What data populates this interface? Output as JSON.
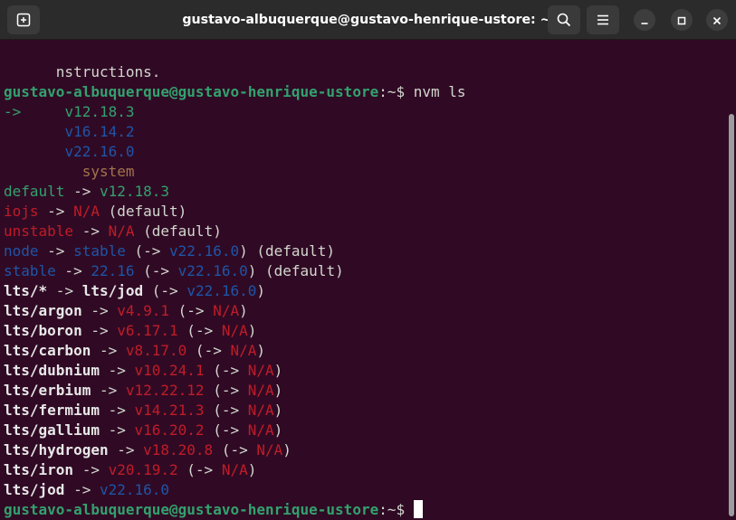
{
  "window": {
    "title": "gustavo-albuquerque@gustavo-henrique-ustore: ~",
    "icons": {
      "new_tab": "new-tab-icon",
      "search": "search-icon",
      "menu": "hamburger-menu-icon",
      "minimize": "minimize-icon",
      "maximize": "maximize-icon",
      "close": "close-icon"
    }
  },
  "colors": {
    "background": "#300a24",
    "prompt_green": "#33a16e",
    "blue": "#1e55a8",
    "red": "#c01c28",
    "text": "#d3d7cf"
  },
  "terminal": {
    "prev_output": "nstructions.",
    "prompt": {
      "user_host": "gustavo-albuquerque@gustavo-henrique-ustore",
      "path_suffix": ":~$ ",
      "command": "nvm ls"
    },
    "versions": {
      "arrow": "->",
      "current": "v12.18.3",
      "v2": "v16.14.2",
      "v3": "v22.16.0",
      "system": "system"
    },
    "aliases": {
      "default": {
        "name": "default",
        "arrow": " -> ",
        "target": "v12.18.3"
      },
      "iojs": {
        "name": "iojs",
        "arrow": " -> ",
        "target": "N/A",
        "suffix": " (default)"
      },
      "unstable": {
        "name": "unstable",
        "arrow": " -> ",
        "target": "N/A",
        "suffix": " (default)"
      },
      "node": {
        "name": "node",
        "arrow": " -> ",
        "target": "stable",
        "open": " (",
        "arrow2": "-> ",
        "resolved": "v22.16.0",
        "close": ")",
        "suffix": " (default)"
      },
      "stable": {
        "name": "stable",
        "arrow": " -> ",
        "target": "22.16",
        "open": " (",
        "arrow2": "-> ",
        "resolved": "v22.16.0",
        "close": ")",
        "suffix": " (default)"
      },
      "lts_star": {
        "name": "lts/*",
        "arrow": " -> ",
        "target": "lts/jod",
        "open": " (",
        "arrow2": "-> ",
        "resolved": "v22.16.0",
        "close": ")"
      }
    },
    "lts": [
      {
        "name": "lts/argon",
        "version": "v4.9.1"
      },
      {
        "name": "lts/boron",
        "version": "v6.17.1"
      },
      {
        "name": "lts/carbon",
        "version": "v8.17.0"
      },
      {
        "name": "lts/dubnium",
        "version": "v10.24.1"
      },
      {
        "name": "lts/erbium",
        "version": "v12.22.12"
      },
      {
        "name": "lts/fermium",
        "version": "v14.21.3"
      },
      {
        "name": "lts/gallium",
        "version": "v16.20.2"
      },
      {
        "name": "lts/hydrogen",
        "version": "v18.20.8"
      },
      {
        "name": "lts/iron",
        "version": "v20.19.2"
      }
    ],
    "lts_na": {
      "arrow": " -> ",
      "open": " (",
      "arrow2": "-> ",
      "value": "N/A",
      "close": ")"
    },
    "lts_jod": {
      "name": "lts/jod",
      "arrow": " -> ",
      "version": "v22.16.0"
    }
  }
}
